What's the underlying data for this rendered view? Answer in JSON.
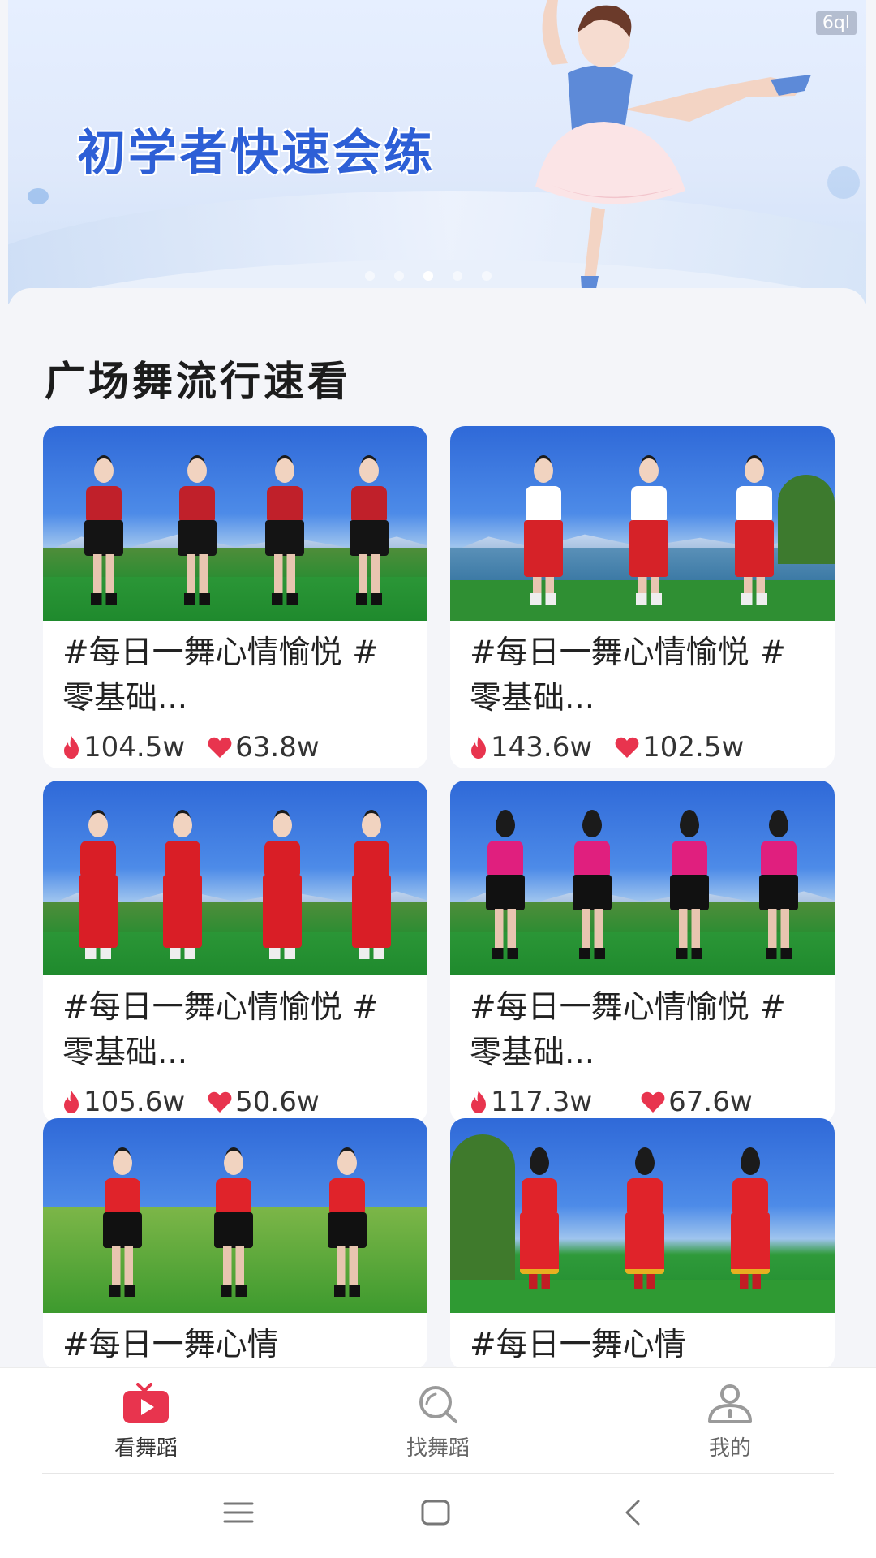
{
  "banner": {
    "title": "初学者快速会练",
    "tag": "6ql",
    "dots": 5,
    "active_dot": 2
  },
  "section": {
    "title": "广场舞流行速看"
  },
  "cards": [
    {
      "title": "#每日一舞心情愉悦 #零基础...",
      "hot": "104.5w",
      "likes": "63.8w"
    },
    {
      "title": "#每日一舞心情愉悦 #零基础...",
      "hot": "143.6w",
      "likes": "102.5w"
    },
    {
      "title": "#每日一舞心情愉悦 #零基础...",
      "hot": "105.6w",
      "likes": "50.6w"
    },
    {
      "title": "#每日一舞心情愉悦 #零基础...",
      "hot": "117.3w",
      "likes": "67.6w"
    },
    {
      "title": "#每日一舞心情",
      "hot": "",
      "likes": ""
    },
    {
      "title": "#每日一舞心情",
      "hot": "",
      "likes": ""
    }
  ],
  "nav": {
    "items": [
      {
        "label": "看舞蹈",
        "icon": "tv-play-icon",
        "active": true
      },
      {
        "label": "找舞蹈",
        "icon": "search-icon",
        "active": false
      },
      {
        "label": "我的",
        "icon": "user-icon",
        "active": false
      }
    ]
  },
  "colors": {
    "accent": "#e8344e",
    "banner_title": "#2d5fd6"
  }
}
